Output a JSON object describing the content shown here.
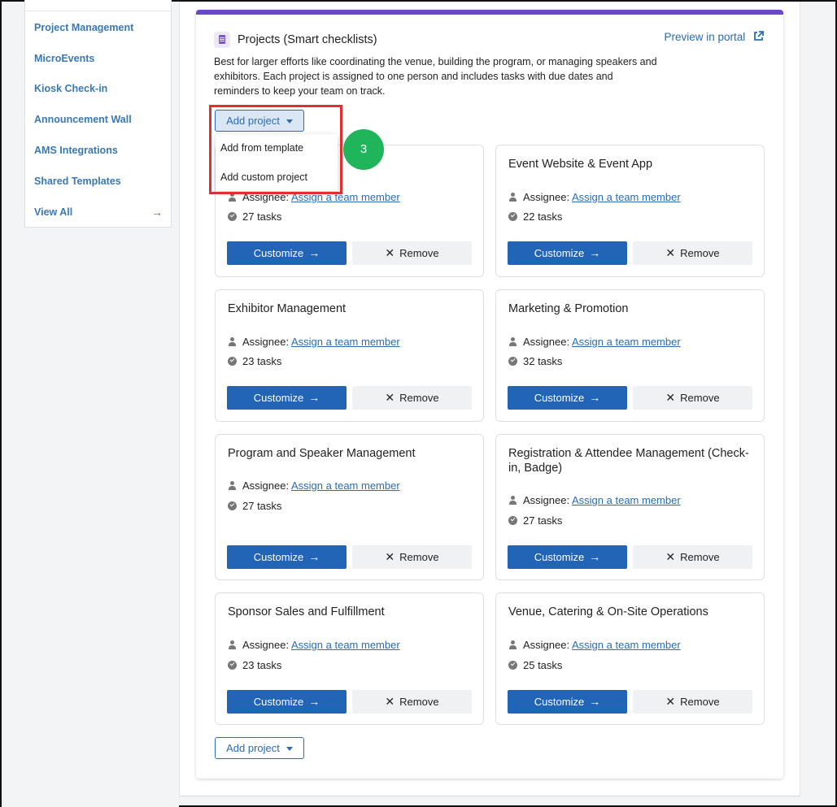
{
  "sidebar": {
    "items": [
      {
        "label": "Project Management"
      },
      {
        "label": "MicroEvents"
      },
      {
        "label": "Kiosk Check-in"
      },
      {
        "label": "Announcement Wall"
      },
      {
        "label": "AMS Integrations"
      },
      {
        "label": "Shared Templates"
      },
      {
        "label": "View All"
      }
    ]
  },
  "panel": {
    "title": "Projects (Smart checklists)",
    "preview_label": "Preview in portal",
    "description": "Best for larger efforts like coordinating the venue, building the program, or managing speakers and exhibitors. Each project is assigned to one person and includes tasks with due dates and reminders to keep your team on track.",
    "accent_color": "#6b48c8"
  },
  "add_project": {
    "label": "Add project",
    "menu": [
      "Add from template",
      "Add custom project"
    ]
  },
  "step_badge": "3",
  "card_common": {
    "assignee_label": "Assignee:",
    "assignee_link": "Assign a team member",
    "customize_label": "Customize",
    "remove_label": "Remove"
  },
  "cards": [
    {
      "title": "",
      "tasks": "27 tasks"
    },
    {
      "title": "Event Website & Event App",
      "tasks": "22 tasks"
    },
    {
      "title": "Exhibitor Management",
      "tasks": "23 tasks"
    },
    {
      "title": "Marketing & Promotion",
      "tasks": "32 tasks"
    },
    {
      "title": "Program and Speaker Management",
      "tasks": "27 tasks"
    },
    {
      "title": "Registration & Attendee Management (Check-in, Badge)",
      "tasks": "27 tasks"
    },
    {
      "title": "Sponsor Sales and Fulfillment",
      "tasks": "23 tasks"
    },
    {
      "title": "Venue, Catering & On-Site Operations",
      "tasks": "25 tasks"
    }
  ],
  "colors": {
    "primary": "#2264b5",
    "link": "#2a6cb3",
    "highlight": "#e02f2f",
    "badge": "#20b45b"
  }
}
